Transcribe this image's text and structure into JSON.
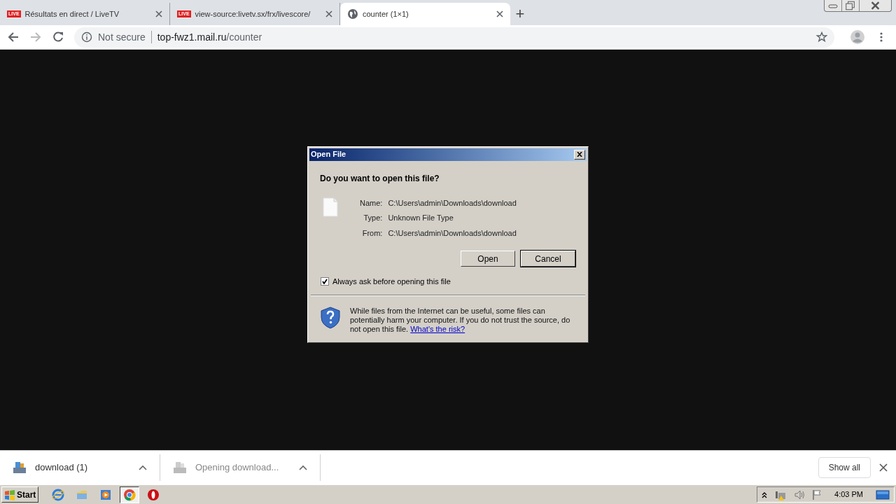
{
  "tabs": [
    {
      "kind": "live",
      "badge": "LIVE",
      "title": "Résultats en direct / LiveTV",
      "selected": false
    },
    {
      "kind": "live",
      "badge": "LIVE",
      "title": "view-source:livetv.sx/frx/livescore/",
      "selected": false
    },
    {
      "kind": "globe",
      "title": "counter (1×1)",
      "selected": true
    }
  ],
  "new_tab": "+",
  "address": {
    "security": "Not secure",
    "host": "top-fwz1.mail.ru",
    "path": "/counter"
  },
  "dialog": {
    "title": "Open File",
    "question": "Do you want to open this file?",
    "fields": [
      {
        "label": "Name:",
        "value": "C:\\Users\\admin\\Downloads\\download"
      },
      {
        "label": "Type:",
        "value": "Unknown File Type"
      },
      {
        "label": "From:",
        "value": "C:\\Users\\admin\\Downloads\\download"
      }
    ],
    "buttons": [
      {
        "label": "Open",
        "default": false
      },
      {
        "label": "Cancel",
        "default": true
      }
    ],
    "checkbox": {
      "label": "Always ask before opening this file",
      "checked": true
    },
    "warning": "While files from the Internet can be useful, some files can potentially harm your computer. If you do not trust the source, do not open this file.",
    "link": "What's the risk?"
  },
  "downloads": [
    {
      "name": "download (1)",
      "pending": false
    },
    {
      "name": "Opening download...",
      "pending": true
    }
  ],
  "show_all": "Show all",
  "taskbar": {
    "start": "Start",
    "apps": [
      {
        "kind": "ie",
        "selected": false
      },
      {
        "kind": "folder",
        "selected": false
      },
      {
        "kind": "media",
        "selected": false
      },
      {
        "kind": "chrome",
        "selected": true
      },
      {
        "kind": "opera",
        "selected": false
      }
    ],
    "clock": "4:03 PM"
  }
}
